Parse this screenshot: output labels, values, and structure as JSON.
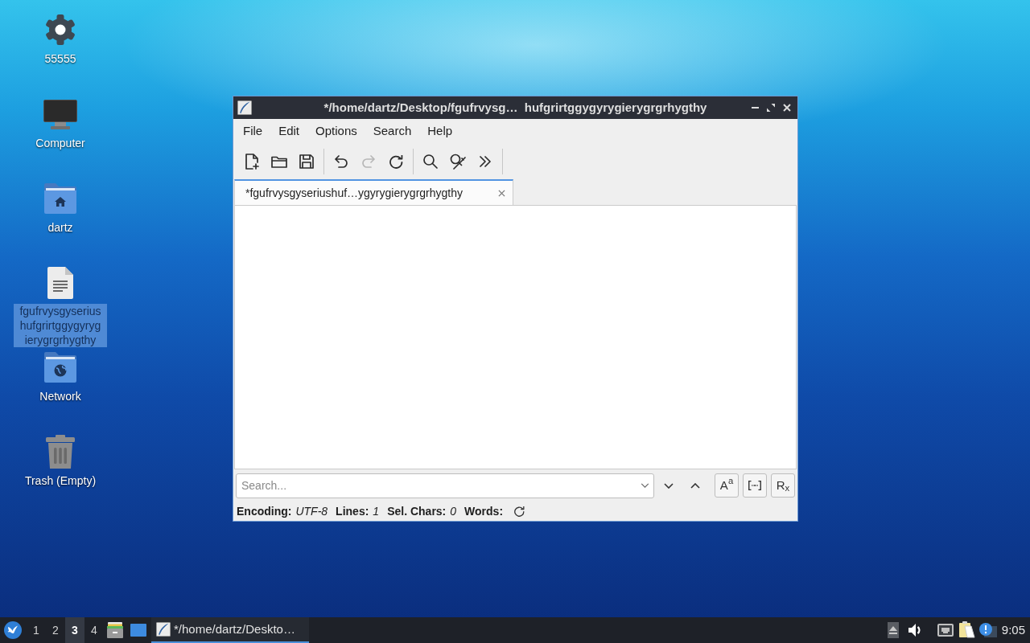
{
  "desktop_icons": [
    {
      "kind": "settings",
      "label": "55555",
      "selected": false
    },
    {
      "kind": "computer",
      "label": "Computer",
      "selected": false
    },
    {
      "kind": "home-folder",
      "label": "dartz",
      "selected": false
    },
    {
      "kind": "text-file",
      "label": "fgufrvysgyseriushufgrirtggygyrygierygrgrhygthy",
      "selected": true
    },
    {
      "kind": "network-folder",
      "label": "Network",
      "selected": false
    },
    {
      "kind": "trash",
      "label": "Trash (Empty)",
      "selected": false
    }
  ],
  "window": {
    "title": "*/home/dartz/Desktop/fgufrvysg…  hufgrirtggygyrygierygrgrhygthy",
    "menu": [
      "File",
      "Edit",
      "Options",
      "Search",
      "Help"
    ],
    "toolbar": [
      {
        "buttons": [
          {
            "kind": "new-file",
            "disabled": false
          },
          {
            "kind": "open",
            "disabled": false
          },
          {
            "kind": "save",
            "disabled": false
          }
        ]
      },
      {
        "buttons": [
          {
            "kind": "undo",
            "disabled": false
          },
          {
            "kind": "redo",
            "disabled": true
          },
          {
            "kind": "reload",
            "disabled": false
          }
        ]
      },
      {
        "buttons": [
          {
            "kind": "find",
            "disabled": false
          },
          {
            "kind": "replace",
            "disabled": false
          },
          {
            "kind": "more",
            "disabled": false
          }
        ]
      }
    ],
    "tabs": [
      {
        "label": "*fgufrvysgyseriushuf…ygyrygierygrgrhygthy",
        "selected": true
      }
    ],
    "search": {
      "placeholder": "Search..."
    },
    "search_toggles": [
      {
        "kind": "match-case",
        "label": "A$^{a}$"
      },
      {
        "kind": "whole-word"
      },
      {
        "kind": "regex",
        "label": "R$_{x}$"
      }
    ],
    "status_bar": [
      {
        "label": "Encoding:",
        "value": "UTF-8"
      },
      {
        "label": "Lines:",
        "value": "1"
      },
      {
        "label": "Sel. Chars:",
        "value": "0"
      },
      {
        "label": "Words:"
      }
    ]
  },
  "taskbar": {
    "workspaces": [
      {
        "label": "1",
        "selected": false
      },
      {
        "label": "2",
        "selected": false
      },
      {
        "label": "3",
        "selected": true
      },
      {
        "label": "4",
        "selected": false
      }
    ],
    "tasks": [
      {
        "label": "*/home/dartz/Deskto…",
        "selected": true
      }
    ],
    "clock": "9:05"
  }
}
